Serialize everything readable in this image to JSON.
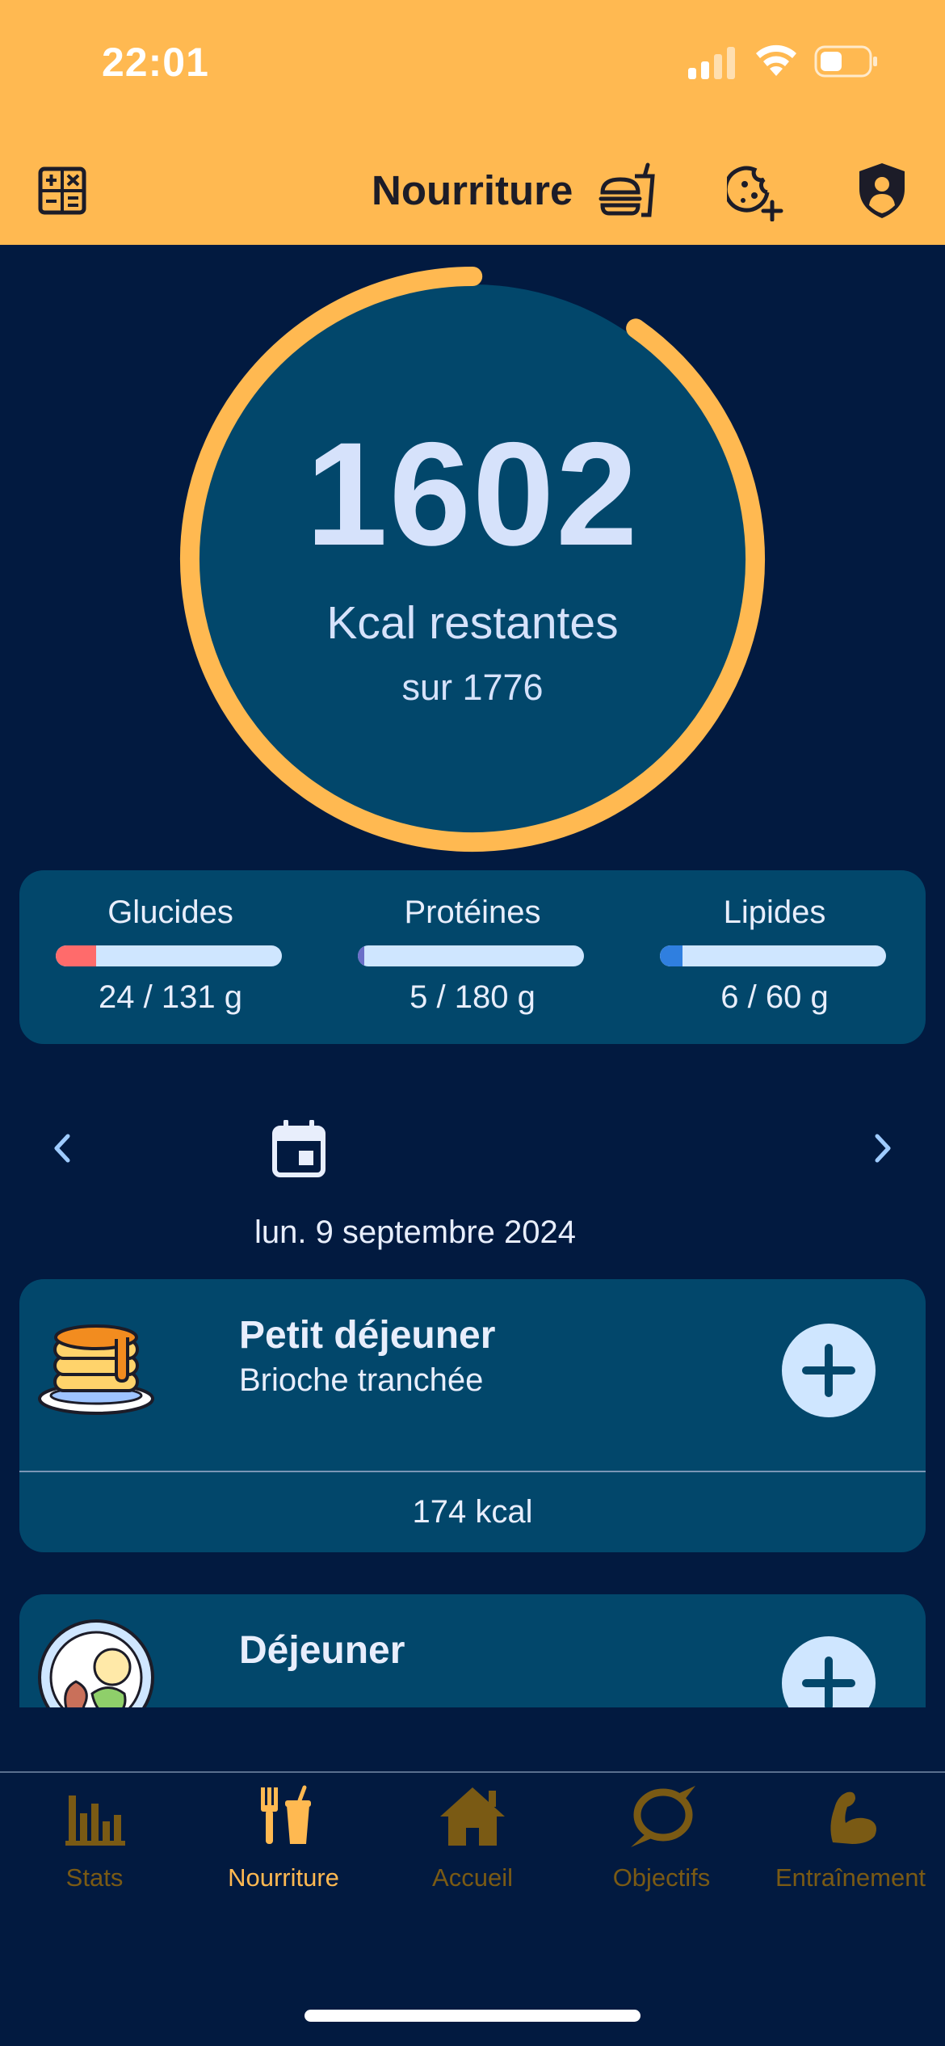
{
  "status_bar": {
    "time": "22:01"
  },
  "header": {
    "title": "Nourriture",
    "icons": [
      "calculator-icon",
      "food-icon",
      "cookie-add-icon",
      "shield-user-icon"
    ]
  },
  "colors": {
    "header_bg": "#ffb951",
    "page_bg": "#021a40",
    "card_bg": "#02476b",
    "accent": "#ffb951",
    "bar_bg": "#cfe6ff",
    "glucides": "#ff6b6b",
    "proteines": "#6b6fc8",
    "lipides": "#2f7fe0",
    "tab_active": "#ffb951",
    "tab_inactive": "#7a5a14"
  },
  "calories": {
    "remaining": "1602",
    "label": "Kcal restantes",
    "total_text": "sur 1776",
    "consumed_fraction": 0.098
  },
  "macros": [
    {
      "name": "Glucides",
      "amount": "24 / 131 g",
      "fraction": 0.18
    },
    {
      "name": "Protéines",
      "amount": "5 / 180 g",
      "fraction": 0.03
    },
    {
      "name": "Lipides",
      "amount": "6 / 60 g",
      "fraction": 0.1
    }
  ],
  "date_nav": {
    "date": "lun. 9 septembre 2024"
  },
  "meals": [
    {
      "title": "Petit déjeuner",
      "subtitle": "Brioche tranchée",
      "kcal": "174 kcal",
      "icon": "pancakes-icon"
    },
    {
      "title": "Déjeuner",
      "subtitle": "",
      "kcal": "",
      "icon": "salad-plate-icon"
    }
  ],
  "tabs": [
    {
      "label": "Stats",
      "icon": "chart-bars-icon",
      "active": false
    },
    {
      "label": "Nourriture",
      "icon": "fork-drink-icon",
      "active": true
    },
    {
      "label": "Accueil",
      "icon": "home-icon",
      "active": false
    },
    {
      "label": "Objectifs",
      "icon": "target-ring-icon",
      "active": false
    },
    {
      "label": "Entraînement",
      "icon": "flexed-arm-icon",
      "active": false
    }
  ]
}
